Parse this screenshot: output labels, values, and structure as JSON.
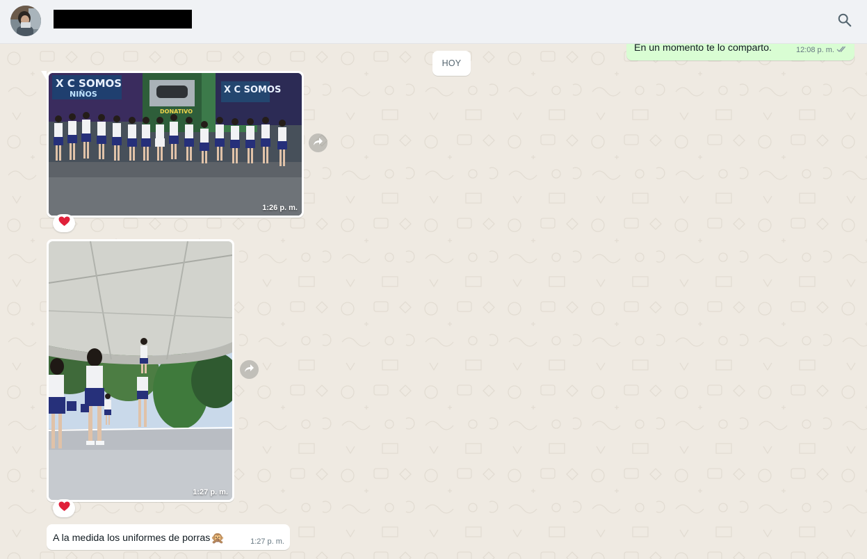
{
  "header": {
    "avatar_icon": "contact-avatar",
    "search_icon": "search-icon"
  },
  "chat": {
    "date_chip": "HOY",
    "outgoing": [
      {
        "text": "En un momento te lo comparto.",
        "time": "12:08 p. m.",
        "status_icon": "double-check-icon"
      }
    ],
    "incoming": [
      {
        "type": "image",
        "time": "1:26 p. m.",
        "reaction": "❤️",
        "forward_icon": "forward-icon"
      },
      {
        "type": "image",
        "time": "1:27 p. m.",
        "reaction": "❤️",
        "forward_icon": "forward-icon"
      },
      {
        "type": "text",
        "text": "A la medida los uniformes de porras",
        "emoji": "🙊",
        "time": "1:27 p. m."
      }
    ]
  },
  "colors": {
    "header_bg": "#f0f2f5",
    "chat_bg": "#efeae2",
    "outgoing_bubble": "#d9fdd3",
    "incoming_bubble": "#ffffff",
    "secondary_text": "#667781",
    "check_marks": "#8696a0"
  }
}
